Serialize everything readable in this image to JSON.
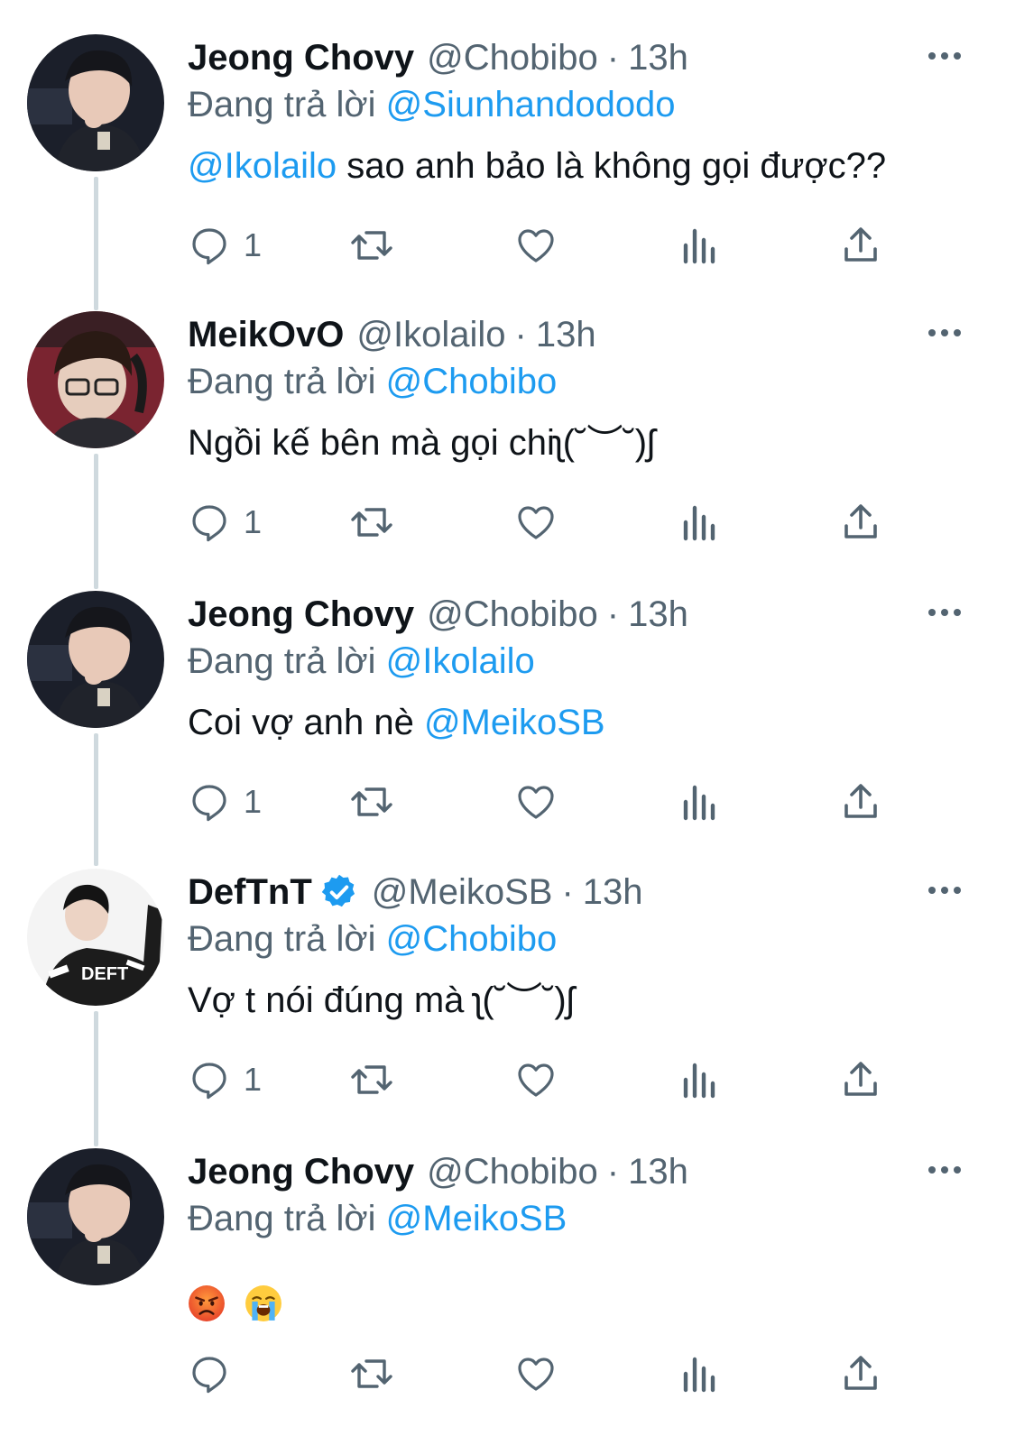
{
  "tweets": [
    {
      "display_name": "Jeong Chovy",
      "handle": "@Chobibo",
      "separator": "·",
      "time": "13h",
      "reply_prefix": "Đang trả lời",
      "reply_to": "@Siunhandododo",
      "text_mention": "@Ikolailo",
      "text": " sao anh bảo là không gọi được??",
      "reply_count": "1",
      "avatar": "chovy-avatar"
    },
    {
      "display_name": "MeikOvO",
      "handle": "@Ikolailo",
      "separator": "·",
      "time": "13h",
      "reply_prefix": "Đang trả lời",
      "reply_to": "@Chobibo",
      "text": "Ngồi kế bên mà gọi chiʅ(˘︶˘)ʃ",
      "reply_count": "1",
      "avatar": "meiko-avatar"
    },
    {
      "display_name": "Jeong Chovy",
      "handle": "@Chobibo",
      "separator": "·",
      "time": "13h",
      "reply_prefix": "Đang trả lời",
      "reply_to": "@Ikolailo",
      "text": "Coi vợ anh nè ",
      "text_mention": "@MeikoSB",
      "reply_count": "1",
      "avatar": "chovy-avatar"
    },
    {
      "display_name": "DefTnT",
      "verified": true,
      "handle": "@MeikoSB",
      "separator": "·",
      "time": "13h",
      "reply_prefix": "Đang trả lời",
      "reply_to": "@Chobibo",
      "text": "Vợ t nói đúng mà ʅ(˘︶˘)ʃ",
      "reply_count": "1",
      "avatar": "deft-avatar",
      "avatar_label": "DEFT"
    },
    {
      "display_name": "Jeong Chovy",
      "handle": "@Chobibo",
      "separator": "·",
      "time": "13h",
      "reply_prefix": "Đang trả lời",
      "reply_to": "@MeikoSB",
      "emojis": [
        "angry-face-emoji",
        "loudly-crying-face-emoji"
      ],
      "reply_count": "",
      "avatar": "chovy-avatar"
    }
  ],
  "colors": {
    "link": "#1d9bf0",
    "muted": "#536471",
    "text": "#0f1419",
    "thread_line": "#cfd9de",
    "verified": "#1d9bf0"
  }
}
